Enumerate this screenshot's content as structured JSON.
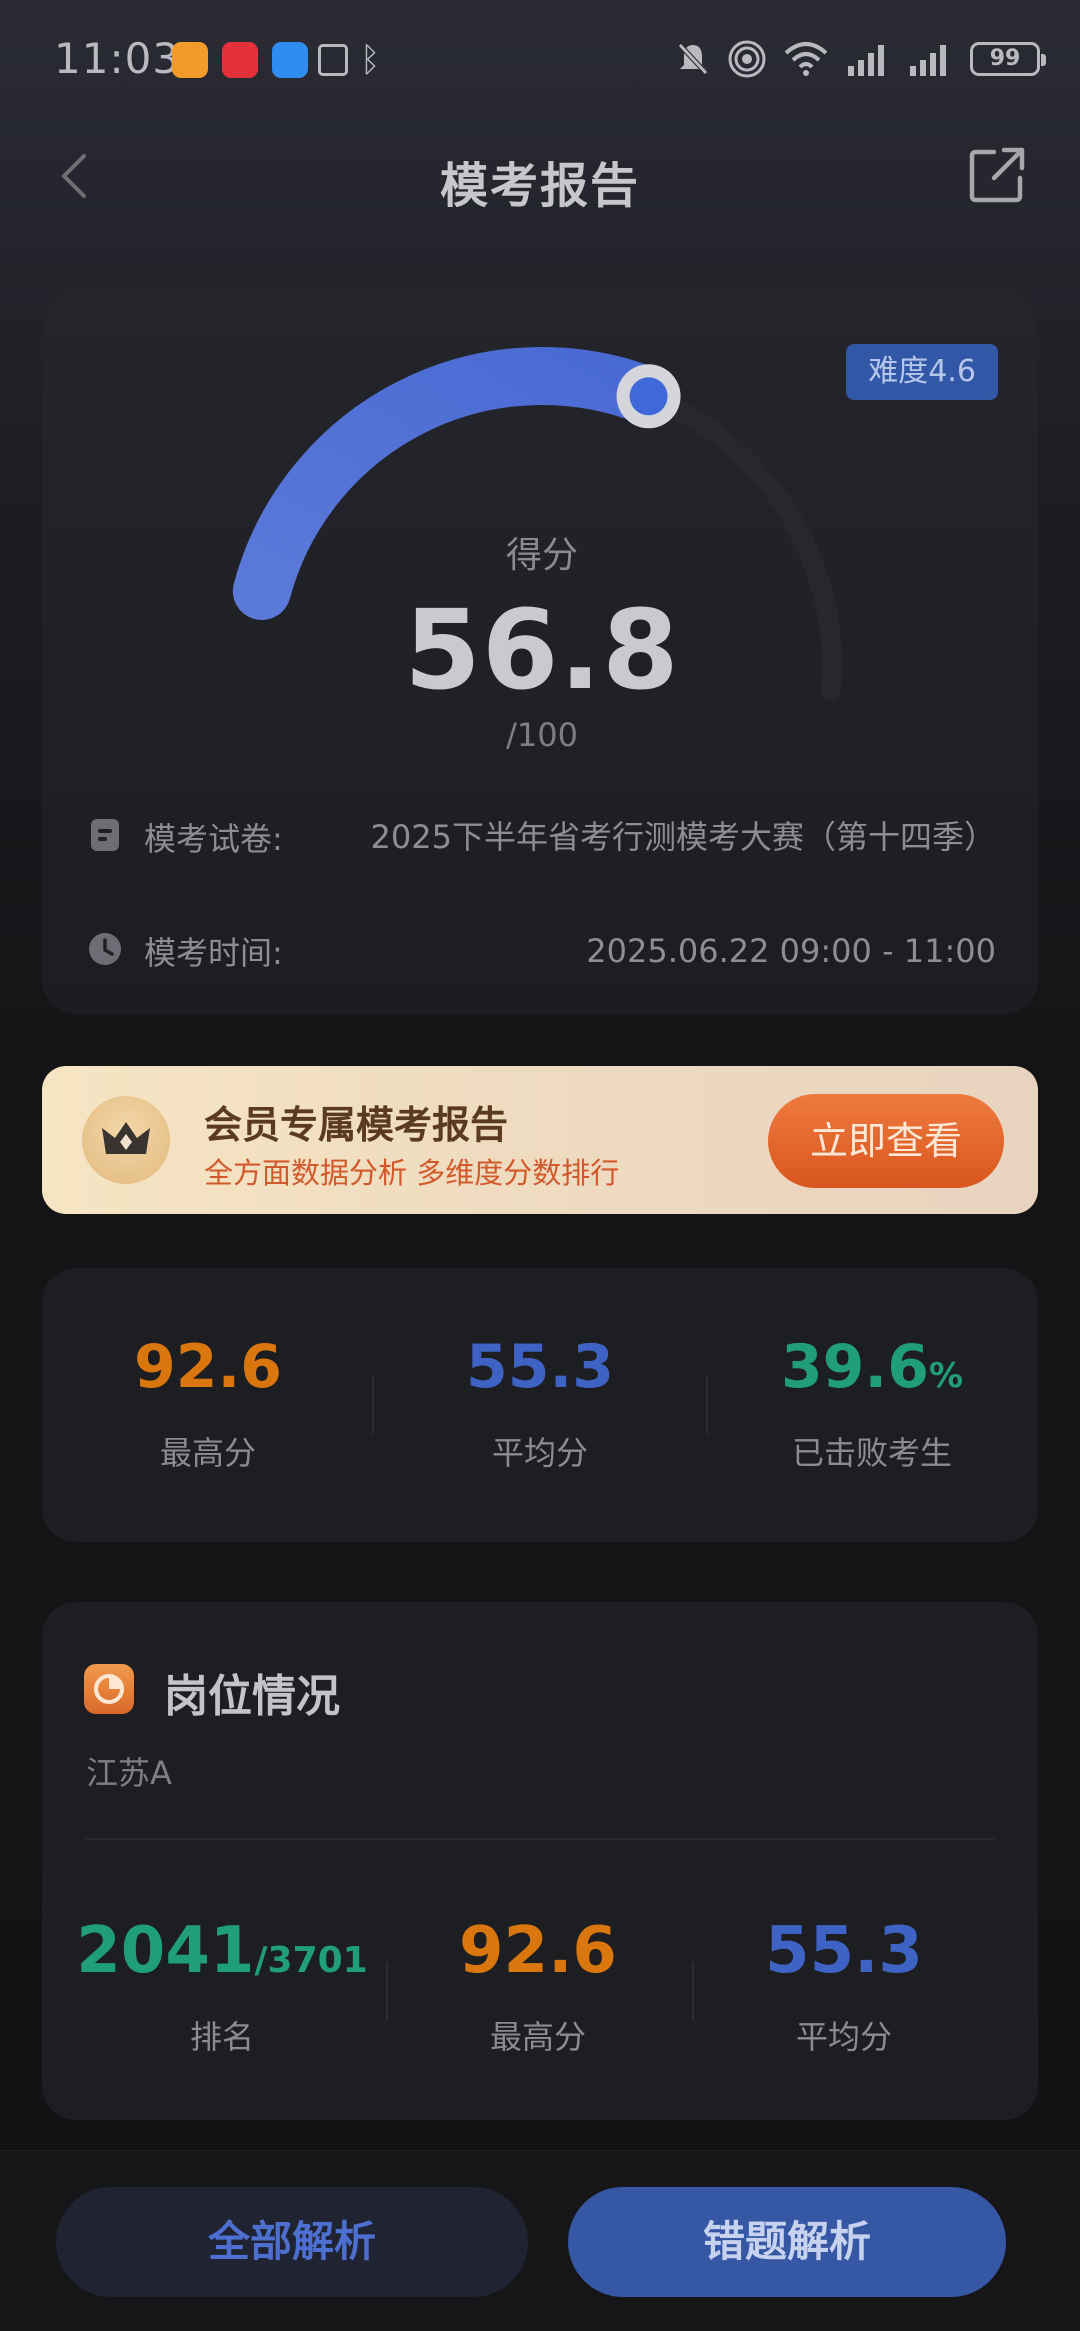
{
  "status_bar": {
    "time": "11:03",
    "battery": "99",
    "icons": [
      "app-orange-icon",
      "huawei-store-icon",
      "message-icon",
      "nfc-icon",
      "bluetooth-icon",
      "mute-bell-icon",
      "hotspot-icon",
      "wifi-icon",
      "signal-icon",
      "signal-icon"
    ]
  },
  "header": {
    "title": "模考报告",
    "back_icon": "chevron-left-icon",
    "share_icon": "share-external-icon"
  },
  "score": {
    "difficulty": "难度4.6",
    "label": "得分",
    "value": "56.8",
    "total": "/100",
    "fraction": 0.568,
    "accent": "#4a6fd6"
  },
  "exam_info": {
    "paper_label": "模考试卷:",
    "paper_value": "2025下半年省考行测模考大赛（第十四季）",
    "time_label": "模考时间:",
    "time_value": "2025.06.22 09:00 - 11:00"
  },
  "vip": {
    "title": "会员专属模考报告",
    "subtitle": "全方面数据分析 多维度分数排行",
    "button": "立即查看"
  },
  "stats": {
    "highest": {
      "value": "92.6",
      "caption": "最高分",
      "color": "#d9770e"
    },
    "average": {
      "value": "55.3",
      "caption": "平均分",
      "color": "#3e63c4"
    },
    "beaten": {
      "value": "39.6",
      "unit": "%",
      "caption": "已击败考生",
      "color": "#1f9e78"
    }
  },
  "post": {
    "title": "岗位情况",
    "region": "江苏A",
    "rank": {
      "value": "2041",
      "total": "/3701",
      "caption": "排名",
      "color": "#1f9e78"
    },
    "highest": {
      "value": "92.6",
      "caption": "最高分",
      "color": "#d9770e"
    },
    "average": {
      "value": "55.3",
      "caption": "平均分",
      "color": "#3e63c4"
    }
  },
  "bottom": {
    "all_analysis": "全部解析",
    "wrong_analysis": "错题解析"
  }
}
